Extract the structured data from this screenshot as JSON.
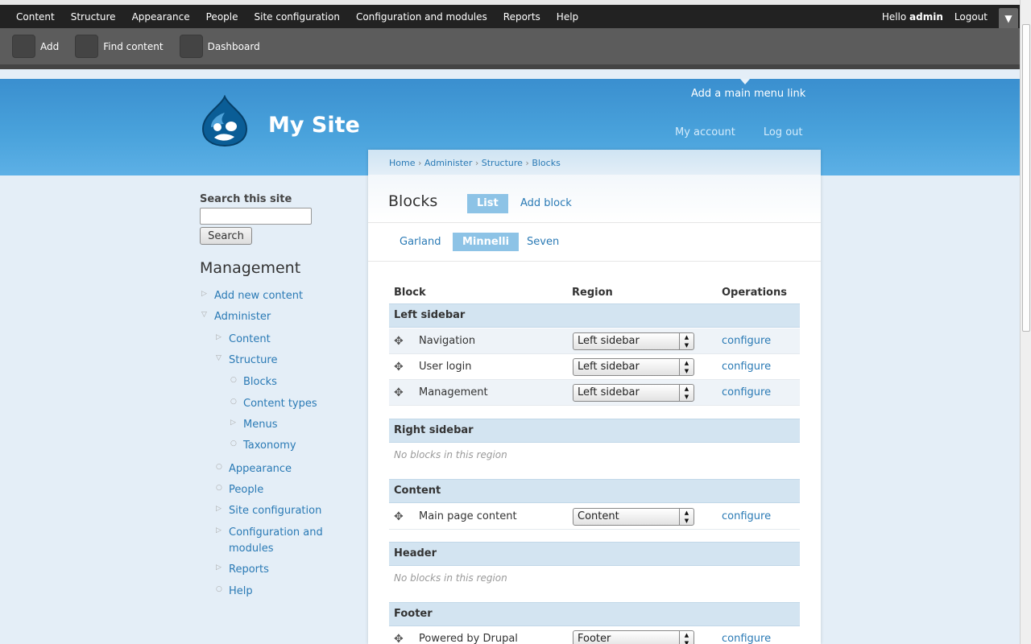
{
  "toolbar": {
    "menu": [
      "Content",
      "Structure",
      "Appearance",
      "People",
      "Site configuration",
      "Configuration and modules",
      "Reports",
      "Help"
    ],
    "hello_prefix": "Hello ",
    "user": "admin",
    "logout": "Logout",
    "toggle_icon": "chevron-down-icon",
    "shortcuts": [
      "Add",
      "Find content",
      "Dashboard"
    ]
  },
  "header": {
    "site_name": "My Site",
    "logo_icon": "drupal-drop-icon",
    "main_menu_link": "Add a main menu link",
    "secondary": [
      "My account",
      "Log out"
    ],
    "bg_color": "#4aa3dc"
  },
  "sidebar": {
    "search_title": "Search this site",
    "search_value": "",
    "search_button": "Search",
    "menu_title": "Management",
    "items": {
      "add_new_content": "Add new content",
      "administer": "Administer",
      "content": "Content",
      "structure": "Structure",
      "blocks": "Blocks",
      "content_types": "Content types",
      "menus": "Menus",
      "taxonomy": "Taxonomy",
      "appearance": "Appearance",
      "people": "People",
      "site_configuration": "Site configuration",
      "config_modules_1": "Configuration and",
      "config_modules_2": "modules",
      "reports": "Reports",
      "help": "Help"
    }
  },
  "main": {
    "breadcrumb": [
      "Home",
      "Administer",
      "Structure",
      "Blocks"
    ],
    "breadcrumb_sep": "›",
    "title": "Blocks",
    "tabs": [
      "List",
      "Add block"
    ],
    "themes": [
      "Garland",
      "Minnelli",
      "Seven"
    ],
    "columns": [
      "Block",
      "Region",
      "Operations"
    ],
    "regions": {
      "left_sidebar": "Left sidebar",
      "right_sidebar": "Right sidebar",
      "content": "Content",
      "header": "Header",
      "footer": "Footer"
    },
    "empty_text": "No blocks in this region",
    "blocks": [
      {
        "name": "Navigation",
        "region": "Left sidebar",
        "op": "configure"
      },
      {
        "name": "User login",
        "region": "Left sidebar",
        "op": "configure"
      },
      {
        "name": "Management",
        "region": "Left sidebar",
        "op": "configure"
      },
      {
        "name": "Main page content",
        "region": "Content",
        "op": "configure"
      },
      {
        "name": "Powered by Drupal",
        "region": "Footer",
        "op": "configure"
      }
    ],
    "accent_color": "#8dc3e6",
    "link_color": "#2a7ab5"
  }
}
